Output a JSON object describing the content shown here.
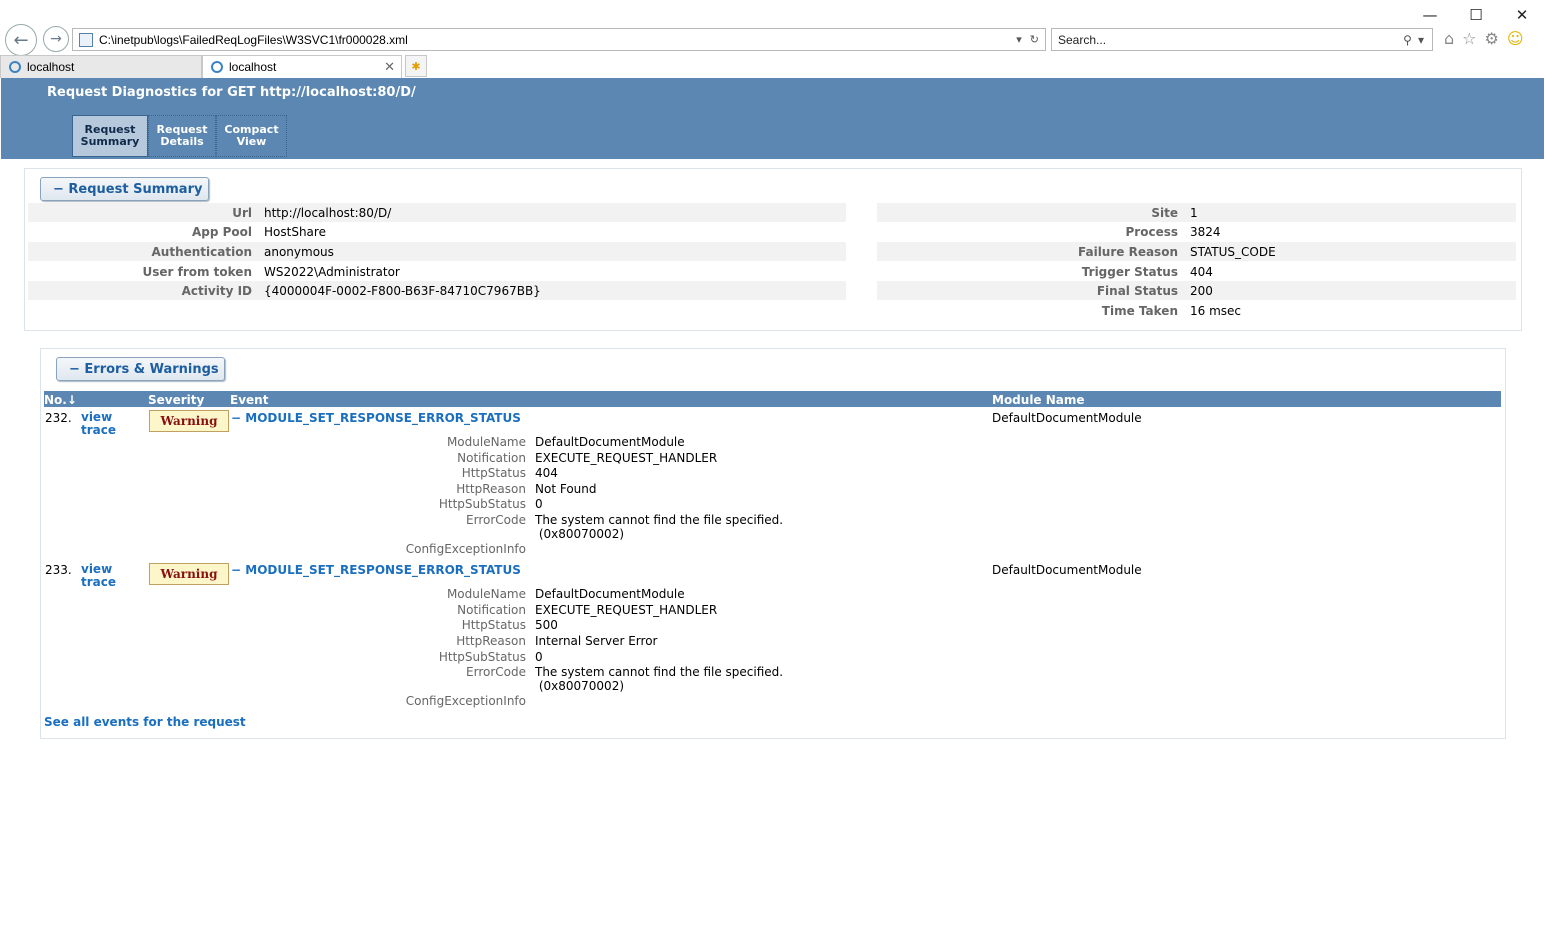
{
  "browser": {
    "window_controls": [
      "—",
      "☐",
      "✕"
    ],
    "address": "C:\\inetpub\\logs\\FailedReqLogFiles\\W3SVC1\\fr000028.xml",
    "search_placeholder": "Search...",
    "tabs": [
      {
        "label": "localhost"
      },
      {
        "label": "localhost"
      }
    ]
  },
  "header": {
    "title": "Request Diagnostics for GET http://localhost:80/D/",
    "views": [
      {
        "line1": "Request",
        "line2": "Summary"
      },
      {
        "line1": "Request",
        "line2": "Details"
      },
      {
        "line1": "Compact",
        "line2": "View"
      }
    ]
  },
  "summary": {
    "heading": "− Request Summary",
    "left": [
      {
        "key": "Url",
        "value": "http://localhost:80/D/"
      },
      {
        "key": "App Pool",
        "value": "HostShare"
      },
      {
        "key": "Authentication",
        "value": "anonymous"
      },
      {
        "key": "User from token",
        "value": "WS2022\\Administrator"
      },
      {
        "key": "Activity ID",
        "value": "{4000004F-0002-F800-B63F-84710C7967BB}"
      }
    ],
    "right": [
      {
        "key": "Site",
        "value": "1"
      },
      {
        "key": "Process",
        "value": "3824"
      },
      {
        "key": "Failure Reason",
        "value": "STATUS_CODE"
      },
      {
        "key": "Trigger Status",
        "value": "404"
      },
      {
        "key": "Final Status",
        "value": "200"
      },
      {
        "key": "Time Taken",
        "value": "16 msec"
      }
    ]
  },
  "errors": {
    "heading": "− Errors & Warnings",
    "columns": {
      "no": "No.↓",
      "severity": "Severity",
      "event": "Event",
      "module": "Module Name"
    },
    "rows": [
      {
        "no": "232.",
        "link1": "view",
        "link2": "trace",
        "severity": "Warning",
        "event": "MODULE_SET_RESPONSE_ERROR_STATUS",
        "module": "DefaultDocumentModule",
        "details": [
          {
            "k": "ModuleName",
            "v": "DefaultDocumentModule"
          },
          {
            "k": "Notification",
            "v": "EXECUTE_REQUEST_HANDLER"
          },
          {
            "k": "HttpStatus",
            "v": "404"
          },
          {
            "k": "HttpReason",
            "v": "Not Found"
          },
          {
            "k": "HttpSubStatus",
            "v": "0"
          },
          {
            "k": "ErrorCode",
            "v": "The system cannot find the file specified.",
            "v2": "(0x80070002)"
          },
          {
            "k": "ConfigExceptionInfo",
            "v": ""
          }
        ]
      },
      {
        "no": "233.",
        "link1": "view",
        "link2": "trace",
        "severity": "Warning",
        "event": "MODULE_SET_RESPONSE_ERROR_STATUS",
        "module": "DefaultDocumentModule",
        "details": [
          {
            "k": "ModuleName",
            "v": "DefaultDocumentModule"
          },
          {
            "k": "Notification",
            "v": "EXECUTE_REQUEST_HANDLER"
          },
          {
            "k": "HttpStatus",
            "v": "500"
          },
          {
            "k": "HttpReason",
            "v": "Internal Server Error"
          },
          {
            "k": "HttpSubStatus",
            "v": "0"
          },
          {
            "k": "ErrorCode",
            "v": "The system cannot find the file specified.",
            "v2": "(0x80070002)"
          },
          {
            "k": "ConfigExceptionInfo",
            "v": ""
          }
        ]
      }
    ],
    "see_all": "See all events for the request"
  }
}
